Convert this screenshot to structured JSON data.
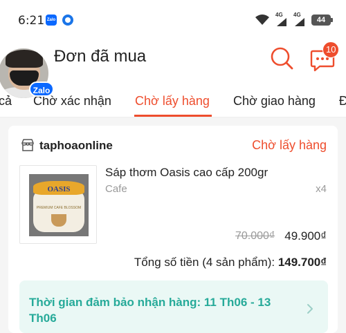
{
  "status_bar": {
    "time": "6:21",
    "notification_icons": [
      "zalo-icon",
      "messenger-icon"
    ],
    "signal_labels": [
      "4G",
      "4G"
    ],
    "battery": "44"
  },
  "header": {
    "title": "Đơn đã mua",
    "chat_badge": "10",
    "avatar_badge": "Zalo"
  },
  "tabs": [
    {
      "label": "cả"
    },
    {
      "label": "Chờ xác nhận"
    },
    {
      "label": "Chờ lấy hàng",
      "active": true
    },
    {
      "label": "Chờ giao hàng"
    },
    {
      "label": "Đ"
    }
  ],
  "order": {
    "shop_name": "taphoaonline",
    "status": "Chờ lấy hàng",
    "product": {
      "name": "Sáp thơm Oasis cao cấp 200gr",
      "variant": "Cafe",
      "quantity": "x4",
      "original_price": "70.000₫",
      "price": "49.900₫",
      "image_brand": "OASIS",
      "image_subtext": "PREMIUM CAFE BLOSSOM"
    },
    "total_label": "Tổng số tiền (4 sản phẩm): ",
    "total_amount": "149.700₫",
    "delivery_guarantee": "Thời gian đảm bảo nhận hàng: 11 Th06 - 13 Th06"
  },
  "colors": {
    "accent": "#ee4d2d",
    "delivery_text": "#26aa99",
    "delivery_bg": "#eaf8f5"
  }
}
